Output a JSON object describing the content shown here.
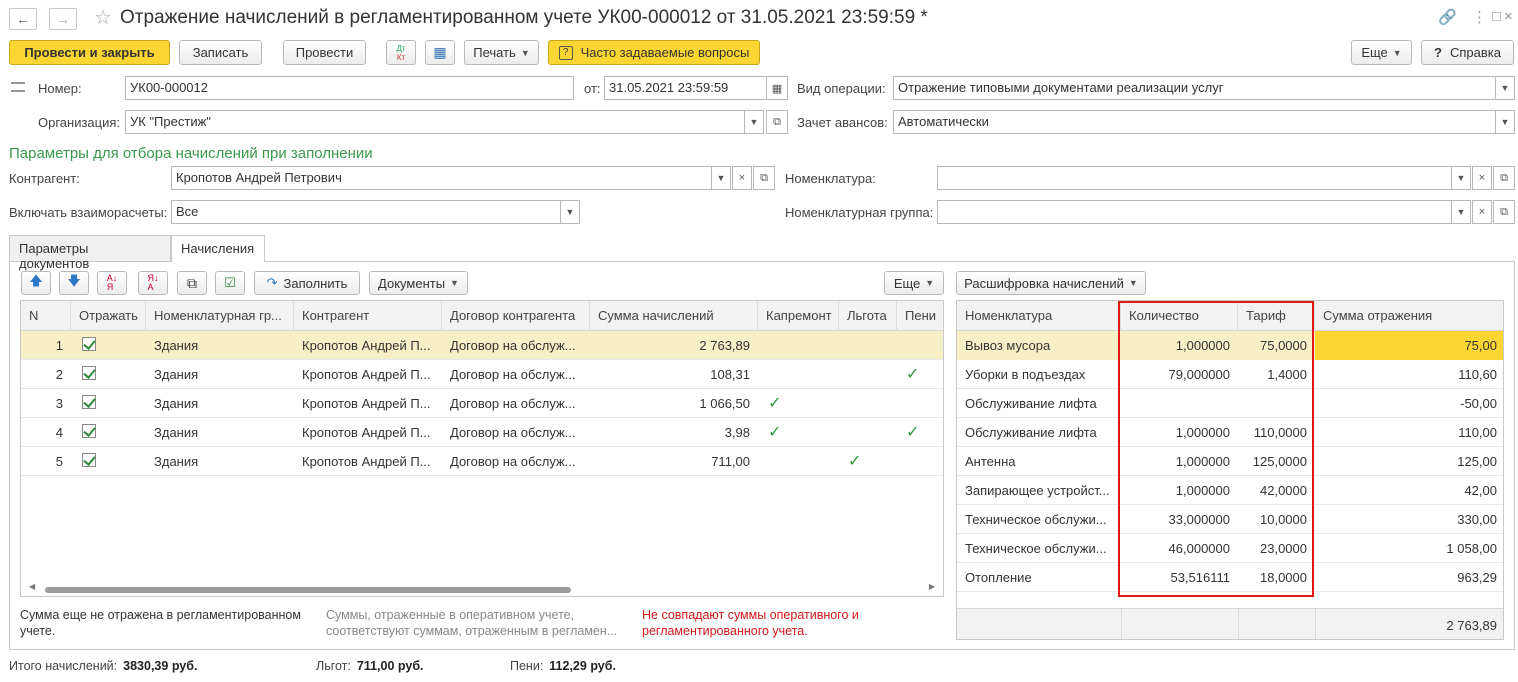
{
  "window": {
    "title": "Отражение начислений в регламентированном учете УК00-000012 от 31.05.2021 23:59:59 *"
  },
  "toolbar": {
    "post_close": "Провести и закрыть",
    "write": "Записать",
    "post": "Провести",
    "dtkt_top": "Дт",
    "dtkt_bottom": "Кт",
    "print": "Печать",
    "faq": "Часто задаваемые вопросы",
    "more": "Еще",
    "help": "Справка"
  },
  "form": {
    "number_label": "Номер:",
    "number": "УК00-000012",
    "date_label": "от:",
    "date": "31.05.2021 23:59:59",
    "op_type_label": "Вид операции:",
    "op_type": "Отражение типовыми документами реализации услуг",
    "org_label": "Организация:",
    "org": "УК \"Престиж\"",
    "advance_label": "Зачет авансов:",
    "advance": "Автоматически",
    "filter_heading": "Параметры для отбора начислений при заполнении",
    "counterparty_label": "Контрагент:",
    "counterparty": "Кропотов Андрей Петрович",
    "nomenclature_label": "Номенклатура:",
    "nomenclature": "",
    "settlements_label": "Включать взаиморасчеты:",
    "settlements": "Все",
    "nom_group_label": "Номенклатурная группа:",
    "nom_group": ""
  },
  "tabs": [
    "Параметры документов",
    "Начисления"
  ],
  "left_toolbar": {
    "fill": "Заполнить",
    "documents": "Документы",
    "more": "Еще"
  },
  "right_toolbar": {
    "decode": "Расшифровка начислений"
  },
  "left_table": {
    "headers": [
      "N",
      "Отражать",
      "Номенклатурная гр...",
      "Контрагент",
      "Договор контрагента",
      "Сумма начислений",
      "Капремонт",
      "Льгота",
      "Пени"
    ],
    "rows": [
      {
        "n": "1",
        "group": "Здания",
        "cp": "Кропотов Андрей П...",
        "contract": "Договор на обслуж...",
        "sum": "2 763,89",
        "kap": false,
        "lg": false,
        "peni": false
      },
      {
        "n": "2",
        "group": "Здания",
        "cp": "Кропотов Андрей П...",
        "contract": "Договор на обслуж...",
        "sum": "108,31",
        "kap": false,
        "lg": false,
        "peni": true
      },
      {
        "n": "3",
        "group": "Здания",
        "cp": "Кропотов Андрей П...",
        "contract": "Договор на обслуж...",
        "sum": "1 066,50",
        "kap": true,
        "lg": false,
        "peni": false
      },
      {
        "n": "4",
        "group": "Здания",
        "cp": "Кропотов Андрей П...",
        "contract": "Договор на обслуж...",
        "sum": "3,98",
        "kap": true,
        "lg": false,
        "peni": true
      },
      {
        "n": "5",
        "group": "Здания",
        "cp": "Кропотов Андрей П...",
        "contract": "Договор на обслуж...",
        "sum": "711,00",
        "kap": false,
        "lg": true,
        "peni": false
      }
    ]
  },
  "right_table": {
    "headers": [
      "Номенклатура",
      "Количество",
      "Тариф",
      "Сумма отражения"
    ],
    "rows": [
      {
        "name": "Вывоз мусора",
        "qty": "1,000000",
        "tariff": "75,0000",
        "sum": "75,00"
      },
      {
        "name": "Уборки в подъездах",
        "qty": "79,000000",
        "tariff": "1,4000",
        "sum": "110,60"
      },
      {
        "name": "Обслуживание лифта",
        "qty": "",
        "tariff": "",
        "sum": "-50,00"
      },
      {
        "name": "Обслуживание лифта",
        "qty": "1,000000",
        "tariff": "110,0000",
        "sum": "110,00"
      },
      {
        "name": "Антенна",
        "qty": "1,000000",
        "tariff": "125,0000",
        "sum": "125,00"
      },
      {
        "name": "Запирающее устройст...",
        "qty": "1,000000",
        "tariff": "42,0000",
        "sum": "42,00"
      },
      {
        "name": "Техническое обслужи...",
        "qty": "33,000000",
        "tariff": "10,0000",
        "sum": "330,00"
      },
      {
        "name": "Техническое обслужи...",
        "qty": "46,000000",
        "tariff": "23,0000",
        "sum": "1 058,00"
      },
      {
        "name": "Отопление",
        "qty": "53,516111",
        "tariff": "18,0000",
        "sum": "963,29"
      }
    ],
    "total": "2 763,89"
  },
  "notes": {
    "not_reflected": "Сумма еще не отражена в регламентированном учете.",
    "match": "Суммы, отраженные в оперативном учете, соответствуют суммам, отраженным в регламен...",
    "mismatch": "Не совпадают суммы оперативного и регламентированного учета."
  },
  "footer": {
    "total_label": "Итого начислений:",
    "total": "3830,39 руб.",
    "benefit_label": "Льгот:",
    "benefit": "711,00 руб.",
    "penalty_label": "Пени:",
    "penalty": "112,29 руб."
  },
  "colors": {
    "accent_yellow": "#fbd633",
    "selected_row": "#f7f0c6",
    "heading_green": "#3a9a4c",
    "mismatch_red": "#d01818",
    "highlight_box": "#e01818"
  }
}
